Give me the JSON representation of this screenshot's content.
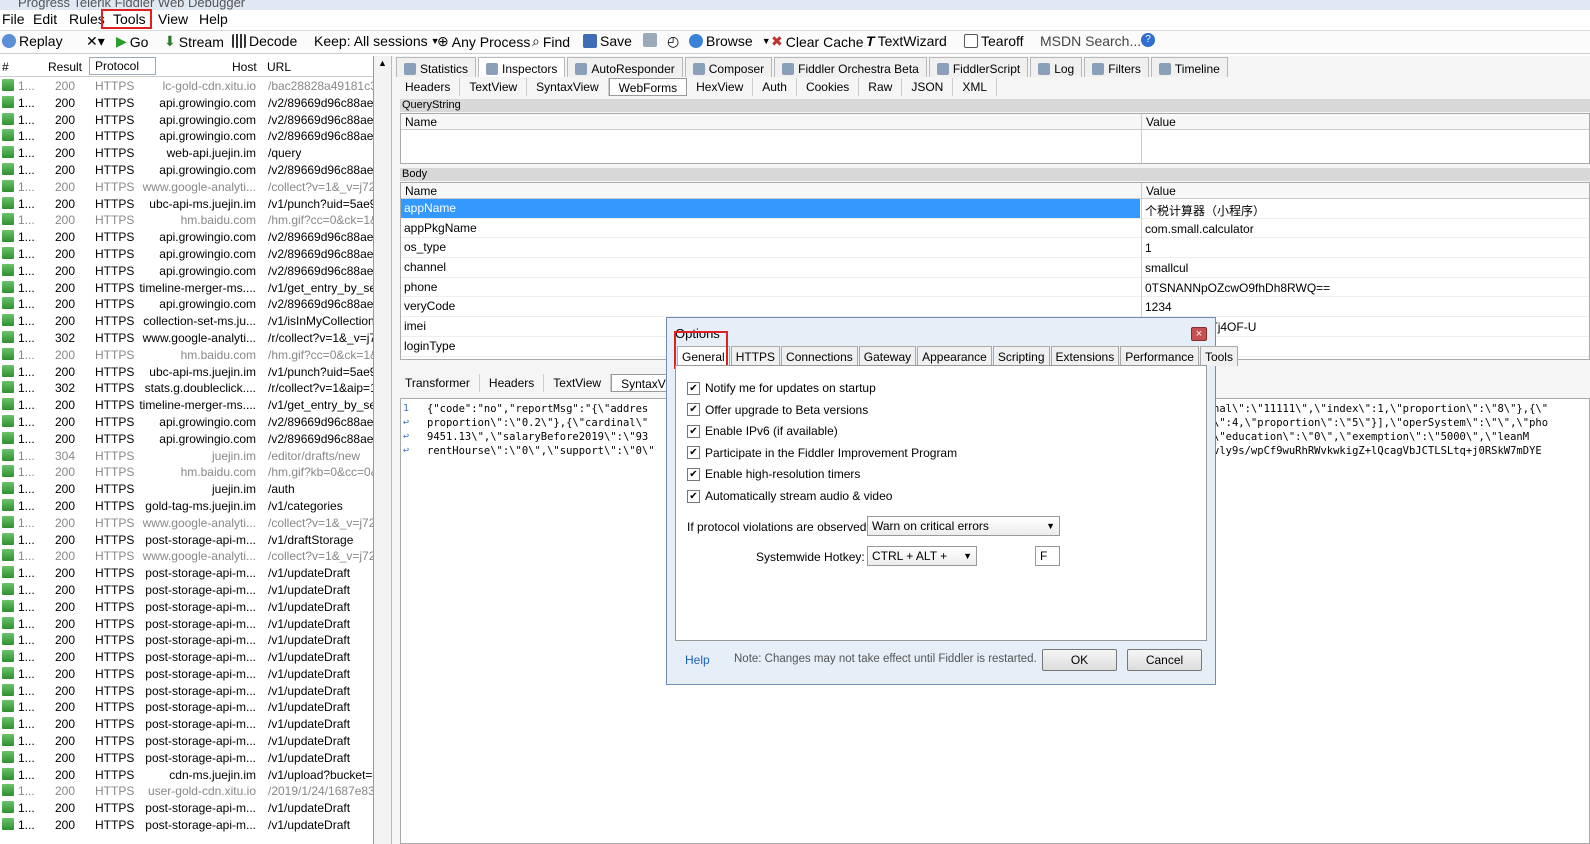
{
  "window": {
    "title": "Progress Telerik Fiddler Web Debugger"
  },
  "menu": [
    "File",
    "Edit",
    "Rules",
    "Tools",
    "View",
    "Help"
  ],
  "toolbar": {
    "replay": "Replay",
    "go": "Go",
    "stream": "Stream",
    "decode": "Decode",
    "keep": "Keep: All sessions",
    "any_process": "Any Process",
    "find": "Find",
    "save": "Save",
    "browse": "Browse",
    "clear_cache": "Clear Cache",
    "textwizard": "TextWizard",
    "tearoff": "Tearoff",
    "msdn_search": "MSDN Search..."
  },
  "sessions": {
    "headers": {
      "num": "#",
      "result": "Result",
      "protocol": "Protocol",
      "host": "Host",
      "url": "URL"
    },
    "rows": [
      {
        "num": "1...",
        "result": "200",
        "protocol": "HTTPS",
        "host": "lc-gold-cdn.xitu.io",
        "url": "/bac28828a49181c34",
        "dim": true
      },
      {
        "num": "1...",
        "result": "200",
        "protocol": "HTTPS",
        "host": "api.growingio.com",
        "url": "/v2/89669d96c88aefb",
        "dim": false
      },
      {
        "num": "1...",
        "result": "200",
        "protocol": "HTTPS",
        "host": "api.growingio.com",
        "url": "/v2/89669d96c88aefb",
        "dim": false
      },
      {
        "num": "1...",
        "result": "200",
        "protocol": "HTTPS",
        "host": "api.growingio.com",
        "url": "/v2/89669d96c88aefb",
        "dim": false
      },
      {
        "num": "1...",
        "result": "200",
        "protocol": "HTTPS",
        "host": "web-api.juejin.im",
        "url": "/query",
        "dim": false
      },
      {
        "num": "1...",
        "result": "200",
        "protocol": "HTTPS",
        "host": "api.growingio.com",
        "url": "/v2/89669d96c88aefb",
        "dim": false
      },
      {
        "num": "1...",
        "result": "200",
        "protocol": "HTTPS",
        "host": "www.google-analyti...",
        "url": "/collect?v=1&_v=j728",
        "dim": true
      },
      {
        "num": "1...",
        "result": "200",
        "protocol": "HTTPS",
        "host": "ubc-api-ms.juejin.im",
        "url": "/v1/punch?uid=5ae95",
        "dim": false
      },
      {
        "num": "1...",
        "result": "200",
        "protocol": "HTTPS",
        "host": "hm.baidu.com",
        "url": "/hm.gif?cc=0&ck=1&c",
        "dim": true
      },
      {
        "num": "1...",
        "result": "200",
        "protocol": "HTTPS",
        "host": "api.growingio.com",
        "url": "/v2/89669d96c88aefb",
        "dim": false
      },
      {
        "num": "1...",
        "result": "200",
        "protocol": "HTTPS",
        "host": "api.growingio.com",
        "url": "/v2/89669d96c88aefb",
        "dim": false
      },
      {
        "num": "1...",
        "result": "200",
        "protocol": "HTTPS",
        "host": "api.growingio.com",
        "url": "/v2/89669d96c88aefb",
        "dim": false
      },
      {
        "num": "1...",
        "result": "200",
        "protocol": "HTTPS",
        "host": "timeline-merger-ms....",
        "url": "/v1/get_entry_by_sel",
        "dim": false
      },
      {
        "num": "1...",
        "result": "200",
        "protocol": "HTTPS",
        "host": "api.growingio.com",
        "url": "/v2/89669d96c88aefb",
        "dim": false
      },
      {
        "num": "1...",
        "result": "200",
        "protocol": "HTTPS",
        "host": "collection-set-ms.ju...",
        "url": "/v1/isInMyCollectionSe",
        "dim": false
      },
      {
        "num": "1...",
        "result": "302",
        "protocol": "HTTPS",
        "host": "www.google-analyti...",
        "url": "/r/collect?v=1&_v=j72",
        "dim": false
      },
      {
        "num": "1...",
        "result": "200",
        "protocol": "HTTPS",
        "host": "hm.baidu.com",
        "url": "/hm.gif?cc=0&ck=1&c",
        "dim": true
      },
      {
        "num": "1...",
        "result": "200",
        "protocol": "HTTPS",
        "host": "ubc-api-ms.juejin.im",
        "url": "/v1/punch?uid=5ae95",
        "dim": false
      },
      {
        "num": "1...",
        "result": "302",
        "protocol": "HTTPS",
        "host": "stats.g.doubleclick....",
        "url": "/r/collect?v=1&aip=1&",
        "dim": false
      },
      {
        "num": "1...",
        "result": "200",
        "protocol": "HTTPS",
        "host": "timeline-merger-ms....",
        "url": "/v1/get_entry_by_sel",
        "dim": false
      },
      {
        "num": "1...",
        "result": "200",
        "protocol": "HTTPS",
        "host": "api.growingio.com",
        "url": "/v2/89669d96c88aefb",
        "dim": false
      },
      {
        "num": "1...",
        "result": "200",
        "protocol": "HTTPS",
        "host": "api.growingio.com",
        "url": "/v2/89669d96c88aefb",
        "dim": false
      },
      {
        "num": "1...",
        "result": "304",
        "protocol": "HTTPS",
        "host": "juejin.im",
        "url": "/editor/drafts/new",
        "dim": true
      },
      {
        "num": "1...",
        "result": "200",
        "protocol": "HTTPS",
        "host": "hm.baidu.com",
        "url": "/hm.gif?kb=0&cc=0&c",
        "dim": true
      },
      {
        "num": "1...",
        "result": "200",
        "protocol": "HTTPS",
        "host": "juejin.im",
        "url": "/auth",
        "dim": false
      },
      {
        "num": "1...",
        "result": "200",
        "protocol": "HTTPS",
        "host": "gold-tag-ms.juejin.im",
        "url": "/v1/categories",
        "dim": false
      },
      {
        "num": "1...",
        "result": "200",
        "protocol": "HTTPS",
        "host": "www.google-analyti...",
        "url": "/collect?v=1&_v=j728",
        "dim": true
      },
      {
        "num": "1...",
        "result": "200",
        "protocol": "HTTPS",
        "host": "post-storage-api-m...",
        "url": "/v1/draftStorage",
        "dim": false
      },
      {
        "num": "1...",
        "result": "200",
        "protocol": "HTTPS",
        "host": "www.google-analyti...",
        "url": "/collect?v=1&_v=j728",
        "dim": true
      },
      {
        "num": "1...",
        "result": "200",
        "protocol": "HTTPS",
        "host": "post-storage-api-m...",
        "url": "/v1/updateDraft",
        "dim": false
      },
      {
        "num": "1...",
        "result": "200",
        "protocol": "HTTPS",
        "host": "post-storage-api-m...",
        "url": "/v1/updateDraft",
        "dim": false
      },
      {
        "num": "1...",
        "result": "200",
        "protocol": "HTTPS",
        "host": "post-storage-api-m...",
        "url": "/v1/updateDraft",
        "dim": false
      },
      {
        "num": "1...",
        "result": "200",
        "protocol": "HTTPS",
        "host": "post-storage-api-m...",
        "url": "/v1/updateDraft",
        "dim": false
      },
      {
        "num": "1...",
        "result": "200",
        "protocol": "HTTPS",
        "host": "post-storage-api-m...",
        "url": "/v1/updateDraft",
        "dim": false
      },
      {
        "num": "1...",
        "result": "200",
        "protocol": "HTTPS",
        "host": "post-storage-api-m...",
        "url": "/v1/updateDraft",
        "dim": false
      },
      {
        "num": "1...",
        "result": "200",
        "protocol": "HTTPS",
        "host": "post-storage-api-m...",
        "url": "/v1/updateDraft",
        "dim": false
      },
      {
        "num": "1...",
        "result": "200",
        "protocol": "HTTPS",
        "host": "post-storage-api-m...",
        "url": "/v1/updateDraft",
        "dim": false
      },
      {
        "num": "1...",
        "result": "200",
        "protocol": "HTTPS",
        "host": "post-storage-api-m...",
        "url": "/v1/updateDraft",
        "dim": false
      },
      {
        "num": "1...",
        "result": "200",
        "protocol": "HTTPS",
        "host": "post-storage-api-m...",
        "url": "/v1/updateDraft",
        "dim": false
      },
      {
        "num": "1...",
        "result": "200",
        "protocol": "HTTPS",
        "host": "post-storage-api-m...",
        "url": "/v1/updateDraft",
        "dim": false
      },
      {
        "num": "1...",
        "result": "200",
        "protocol": "HTTPS",
        "host": "post-storage-api-m...",
        "url": "/v1/updateDraft",
        "dim": false
      },
      {
        "num": "1...",
        "result": "200",
        "protocol": "HTTPS",
        "host": "cdn-ms.juejin.im",
        "url": "/v1/upload?bucket=go",
        "dim": false
      },
      {
        "num": "1...",
        "result": "200",
        "protocol": "HTTPS",
        "host": "user-gold-cdn.xitu.io",
        "url": "/2019/1/24/1687e83b",
        "dim": true
      },
      {
        "num": "1...",
        "result": "200",
        "protocol": "HTTPS",
        "host": "post-storage-api-m...",
        "url": "/v1/updateDraft",
        "dim": false
      },
      {
        "num": "1...",
        "result": "200",
        "protocol": "HTTPS",
        "host": "post-storage-api-m...",
        "url": "/v1/updateDraft",
        "dim": false
      }
    ]
  },
  "main_tabs": [
    "Statistics",
    "Inspectors",
    "AutoResponder",
    "Composer",
    "Fiddler Orchestra Beta",
    "FiddlerScript",
    "Log",
    "Filters",
    "Timeline"
  ],
  "request_subtabs": [
    "Headers",
    "TextView",
    "SyntaxView",
    "WebForms",
    "HexView",
    "Auth",
    "Cookies",
    "Raw",
    "JSON",
    "XML"
  ],
  "querystring": {
    "label": "QueryString",
    "col_name": "Name",
    "col_value": "Value"
  },
  "body": {
    "label": "Body",
    "col_name": "Name",
    "col_value": "Value",
    "rows": [
      {
        "name": "appName",
        "value": "个税计算器（小程序）"
      },
      {
        "name": "appPkgName",
        "value": "com.small.calculator"
      },
      {
        "name": "os_type",
        "value": "1"
      },
      {
        "name": "channel",
        "value": "smallcul"
      },
      {
        "name": "phone",
        "value": "0TSNANNpOZcwO9fhDh8RWQ=="
      },
      {
        "name": "veryCode",
        "value": "1234"
      },
      {
        "name": "imei",
        "value": "PGCLiVRqgTj4OF-U"
      },
      {
        "name": "loginType",
        "value": ""
      }
    ]
  },
  "response_subtabs": [
    "Transformer",
    "Headers",
    "TextView",
    "SyntaxView"
  ],
  "code_lines": [
    {
      "ln": "1",
      "left": "{\"code\":\"no\",\"reportMsg\":\"{\\\"addres",
      "right": "nal\\\":\\\"11111\\\",\\\"index\\\":1,\\\"proportion\\\":\\\"8\\\"},{\\\""
    },
    {
      "ln": "↩",
      "left": "proportion\\\":\\\"0.2\\\"},{\\\"cardinal\\\"",
      "right": "\\\":4,\\\"proportion\\\":\\\"5\\\"}],\\\"operSystem\\\":\\\"\\\",\\\"pho"
    },
    {
      "ln": "↩",
      "left": "9451.13\\\",\\\"salaryBefore2019\\\":\\\"93",
      "right": "\\\"education\\\":\\\"0\\\",\\\"exemption\\\":\\\"5000\\\",\\\"leanM"
    },
    {
      "ln": "↩",
      "left": "rentHourse\\\":\\\"0\\\",\\\"support\\\":\\\"0\\\"",
      "right": "vly9s/wpCf9wuRhRWvkwkigZ+lQcagVbJCTLSLtq+j0RSkW7mDYE"
    }
  ],
  "dialog": {
    "title": "Options",
    "close": "×",
    "tabs": [
      "General",
      "HTTPS",
      "Connections",
      "Gateway",
      "Appearance",
      "Scripting",
      "Extensions",
      "Performance",
      "Tools"
    ],
    "checkboxes": [
      {
        "label": "Notify me for updates on startup",
        "checked": true
      },
      {
        "label": "Offer upgrade to Beta versions",
        "checked": true
      },
      {
        "label": "Enable IPv6 (if available)",
        "checked": true
      },
      {
        "label": "Participate in the Fiddler Improvement Program",
        "checked": true
      },
      {
        "label": "Enable high-resolution timers",
        "checked": true
      },
      {
        "label": "Automatically stream audio & video",
        "checked": true
      }
    ],
    "protocol_label": "If protocol violations are observed:",
    "protocol_value": "Warn on critical errors",
    "hotkey_label": "Systemwide Hotkey:",
    "hotkey_value": "CTRL + ALT +",
    "hotkey_key": "F",
    "help": "Help",
    "note": "Note: Changes may not take effect until Fiddler is restarted.",
    "ok": "OK",
    "cancel": "Cancel"
  },
  "colors": {
    "selection": "#3399ff",
    "highlight_box": "#e02020",
    "dialog_bg": "#e6eef8"
  }
}
